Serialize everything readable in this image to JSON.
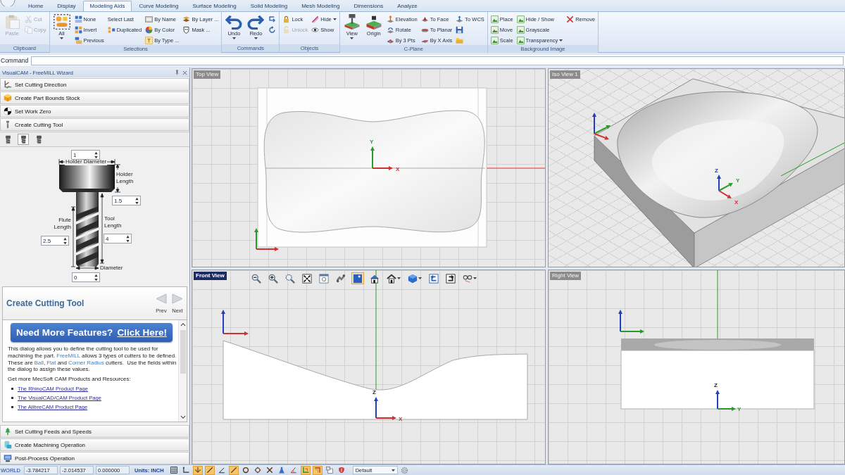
{
  "ribbon": {
    "tabs": [
      {
        "label": "Home",
        "selected": false
      },
      {
        "label": "Display",
        "selected": false
      },
      {
        "label": "Modeling Aids",
        "selected": true
      },
      {
        "label": "Curve Modeling",
        "selected": false
      },
      {
        "label": "Surface Modeling",
        "selected": false
      },
      {
        "label": "Solid Modeling",
        "selected": false
      },
      {
        "label": "Mesh Modeling",
        "selected": false
      },
      {
        "label": "Dimensions",
        "selected": false
      },
      {
        "label": "Analyze",
        "selected": false
      }
    ],
    "groups": [
      {
        "title": "Clipboard",
        "columns": [
          [
            {
              "kind": "large",
              "label": "Paste",
              "disabled": true
            }
          ],
          [
            {
              "kind": "small",
              "label": "Cut",
              "disabled": true
            },
            {
              "kind": "small",
              "label": "Copy",
              "disabled": true
            }
          ]
        ]
      },
      {
        "title": "Selections",
        "columns": [
          [
            {
              "kind": "large",
              "label": "All",
              "disabled": false,
              "dropdown": true
            }
          ],
          [
            {
              "kind": "small",
              "label": "None",
              "disabled": false
            },
            {
              "kind": "small",
              "label": "Invert",
              "disabled": false
            },
            {
              "kind": "small",
              "label": "Previous",
              "disabled": false
            }
          ],
          [
            {
              "kind": "text",
              "label": "Select Last",
              "disabled": false
            },
            {
              "kind": "small",
              "label": "Duplicated",
              "disabled": false
            }
          ],
          [
            {
              "kind": "small",
              "label": "By Name",
              "disabled": false
            },
            {
              "kind": "small",
              "label": "By Color",
              "disabled": false
            },
            {
              "kind": "small",
              "label": "By Type ...",
              "disabled": false
            }
          ],
          [
            {
              "kind": "small",
              "label": "By Layer ...",
              "disabled": false
            },
            {
              "kind": "small",
              "label": "Mask ...",
              "disabled": false
            }
          ]
        ]
      },
      {
        "title": "Commands",
        "columns": [
          [
            {
              "kind": "large",
              "label": "Undo",
              "disabled": false,
              "dropdown": true
            }
          ],
          [
            {
              "kind": "large",
              "label": "Redo",
              "disabled": false,
              "dropdown": true
            }
          ],
          [
            {
              "kind": "icon",
              "disabled": false
            },
            {
              "kind": "icon",
              "disabled": false
            }
          ]
        ]
      },
      {
        "title": "Objects",
        "columns": [
          [
            {
              "kind": "small",
              "label": "Lock",
              "disabled": false
            },
            {
              "kind": "small",
              "label": "Unlock",
              "disabled": true
            }
          ],
          [
            {
              "kind": "small",
              "label": "Hide",
              "disabled": false,
              "dropdown": true
            },
            {
              "kind": "small",
              "label": "Show",
              "disabled": false
            }
          ]
        ]
      },
      {
        "title": "C-Plane",
        "columns": [
          [
            {
              "kind": "large",
              "label": "View",
              "disabled": false,
              "dropdown": true
            }
          ],
          [
            {
              "kind": "large",
              "label": "Origin",
              "disabled": false
            }
          ],
          [
            {
              "kind": "small",
              "label": "Elevation",
              "disabled": false
            },
            {
              "kind": "small",
              "label": "Rotate",
              "disabled": false
            },
            {
              "kind": "small",
              "label": "By 3 Pts",
              "disabled": false
            }
          ],
          [
            {
              "kind": "small",
              "label": "To Face",
              "disabled": false
            },
            {
              "kind": "small",
              "label": "To Planar",
              "disabled": false
            },
            {
              "kind": "small",
              "label": "By X Axis",
              "disabled": false
            }
          ],
          [
            {
              "kind": "small",
              "label": "To WCS",
              "disabled": false
            },
            {
              "kind": "icon",
              "disabled": false
            },
            {
              "kind": "icon",
              "disabled": false
            }
          ]
        ]
      },
      {
        "title": "Background Image",
        "columns": [
          [
            {
              "kind": "small",
              "label": "Place",
              "disabled": false
            },
            {
              "kind": "small",
              "label": "Move",
              "disabled": false
            },
            {
              "kind": "small",
              "label": "Scale",
              "disabled": false
            }
          ],
          [
            {
              "kind": "small",
              "label": "Hide / Show",
              "disabled": false
            },
            {
              "kind": "small",
              "label": "Grayscale",
              "disabled": false
            },
            {
              "kind": "small",
              "label": "Transparency",
              "disabled": false,
              "dropdown": true
            }
          ],
          [
            {
              "kind": "small",
              "label": "Remove",
              "disabled": false
            }
          ]
        ]
      }
    ]
  },
  "command": {
    "label": "Command"
  },
  "wizard": {
    "title": "VisualCAM - FreeMILL Wizard",
    "steps_top": [
      {
        "label": "Set Cutting Direction"
      },
      {
        "label": "Create Part Bounds Stock"
      },
      {
        "label": "Set Work Zero"
      },
      {
        "label": "Create Cutting Tool"
      }
    ],
    "tool_types": [
      {
        "selected": false
      },
      {
        "selected": true
      },
      {
        "selected": false
      }
    ],
    "tool_fields": [
      {
        "kind": "holder_diameter",
        "label": "Holder Diameter",
        "value": "1"
      },
      {
        "kind": "holder_length",
        "label": "Holder Length",
        "value": "1.5"
      },
      {
        "kind": "flute_length",
        "label": "Flute Length",
        "value": "2.5"
      },
      {
        "kind": "tool_length",
        "label": "Tool Length",
        "value": "4"
      },
      {
        "kind": "diameter",
        "label": "Diameter",
        "value": "0"
      }
    ],
    "info": {
      "title": "Create Cutting Tool",
      "prev": "Prev",
      "next": "Next",
      "banner": {
        "text": "Need More Features?",
        "link": "Click Here!"
      },
      "paragraph": [
        {
          "text": "This dialog allows you to define the cutting tool to be used for machining the part. ",
          "highlight": false
        },
        {
          "text": "FreeMILL",
          "highlight": true
        },
        {
          "text": " allows 3 types of cutters to be defined.  These are ",
          "highlight": false
        },
        {
          "text": "Ball",
          "highlight": true
        },
        {
          "text": ", ",
          "highlight": false
        },
        {
          "text": "Flat",
          "highlight": true
        },
        {
          "text": " and ",
          "highlight": false
        },
        {
          "text": "Corner Radius",
          "highlight": true
        },
        {
          "text": " cutters.  Use the fields within the dialog to assign these values.",
          "highlight": false
        }
      ],
      "resources_heading": "Get more MecSoft CAM Products and Resources:",
      "links": [
        "The RhinoCAM Product Page",
        "The VisualCAD/CAM Product Page",
        "The AlibreCAM Product Page"
      ]
    },
    "steps_bottom": [
      {
        "label": "Set Cutting Feeds and Speeds"
      },
      {
        "label": "Create Machining Operation"
      },
      {
        "label": "Post-Process Operation"
      }
    ]
  },
  "viewports": [
    {
      "kind": "top",
      "title": "Top View",
      "active": false,
      "axis_labels": [
        "Y",
        "X"
      ]
    },
    {
      "kind": "iso",
      "title": "Iso View 1",
      "active": false,
      "axis_labels": [
        "Z",
        "Y",
        "X"
      ]
    },
    {
      "kind": "front",
      "title": "Front View",
      "active": true,
      "axis_labels": [
        "Z",
        "X"
      ],
      "toolbar": [
        {
          "selected": false
        },
        {
          "selected": false
        },
        {
          "selected": false
        },
        {
          "selected": false
        },
        {
          "selected": false
        },
        {
          "selected": false
        },
        {
          "selected": true
        },
        {
          "selected": false
        },
        {
          "selected": false,
          "dropdown": true
        },
        {
          "selected": false,
          "dropdown": true
        },
        {
          "selected": false
        },
        {
          "selected": false
        },
        {
          "selected": false,
          "dropdown": true
        }
      ]
    },
    {
      "kind": "right",
      "title": "Right View",
      "active": false,
      "axis_labels": [
        "Z",
        "Y"
      ]
    }
  ],
  "status_bar": {
    "coordinate_system": "WORLD",
    "fields": [
      "-3.784217",
      "-2.014537",
      "0.000000"
    ],
    "units": "Units: INCH",
    "snaps": [
      {
        "on": true
      },
      {
        "on": true
      },
      {
        "on": false
      },
      {
        "on": true
      },
      {
        "on": false
      },
      {
        "on": false
      },
      {
        "on": false
      },
      {
        "on": false
      },
      {
        "on": false
      },
      {
        "on": true
      },
      {
        "on": true
      },
      {
        "on": false
      },
      {
        "on": false
      }
    ],
    "layer": "Default"
  }
}
